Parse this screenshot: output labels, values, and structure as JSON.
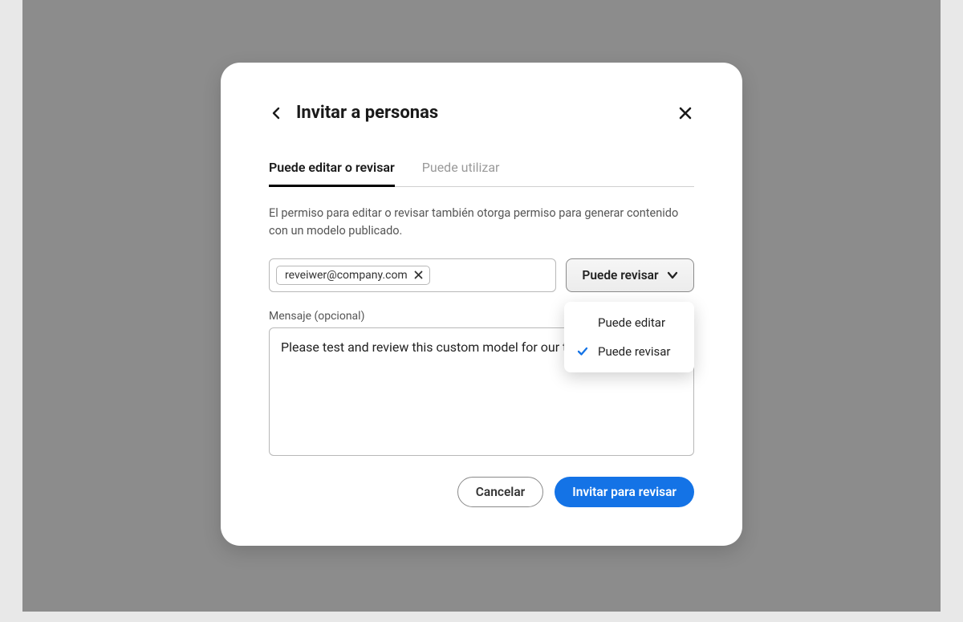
{
  "dialog": {
    "title": "Invitar a personas",
    "tabs": [
      {
        "label": "Puede editar o revisar",
        "active": true
      },
      {
        "label": "Puede utilizar",
        "active": false
      }
    ],
    "permission_description": "El permiso para editar o revisar también otorga permiso para generar contenido con un modelo publicado.",
    "email_chip": "reveiwer@company.com",
    "permission_selector": {
      "selected": "Puede revisar",
      "options": [
        {
          "label": "Puede editar",
          "selected": false
        },
        {
          "label": "Puede revisar",
          "selected": true
        }
      ]
    },
    "message_label": "Mensaje (opcional)",
    "message_value": "Please test and review this custom model for our team.",
    "cancel_label": "Cancelar",
    "submit_label": "Invitar para revisar"
  }
}
